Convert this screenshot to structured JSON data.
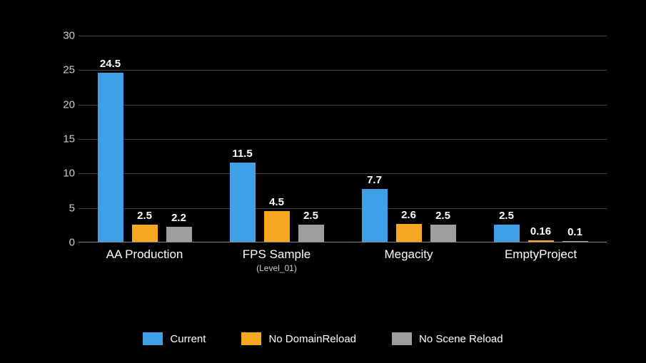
{
  "chart_data": {
    "type": "bar",
    "categories": [
      "AA Production",
      "FPS Sample",
      "Megacity",
      "EmptyProject"
    ],
    "category_subs": [
      "",
      "(Level_01)",
      "",
      ""
    ],
    "series": [
      {
        "name": "Current",
        "color": "#3ea1e8",
        "values": [
          24.5,
          11.5,
          7.7,
          2.5
        ]
      },
      {
        "name": "No DomainReload",
        "color": "#f5a623",
        "values": [
          2.5,
          4.5,
          2.6,
          0.16
        ]
      },
      {
        "name": "No Scene Reload",
        "color": "#9e9e9e",
        "values": [
          2.2,
          2.5,
          2.5,
          0.1
        ]
      }
    ],
    "ylim": [
      0,
      30
    ],
    "yticks": [
      0,
      5,
      10,
      15,
      20,
      25,
      30
    ],
    "title": "",
    "xlabel": "",
    "ylabel": ""
  }
}
